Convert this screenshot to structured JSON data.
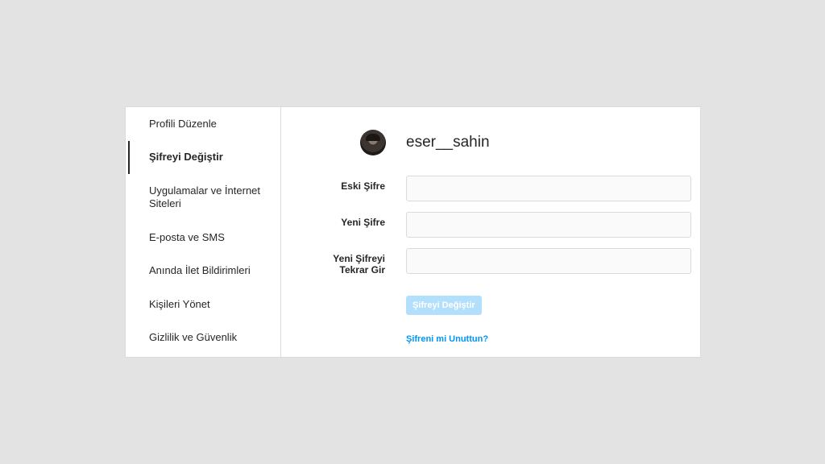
{
  "sidebar": {
    "items": [
      {
        "label": "Profili Düzenle"
      },
      {
        "label": "Şifreyi Değiştir"
      },
      {
        "label": "Uygulamalar ve İnternet Siteleri"
      },
      {
        "label": "E-posta ve SMS"
      },
      {
        "label": "Anında İlet Bildirimleri"
      },
      {
        "label": "Kişileri Yönet"
      },
      {
        "label": "Gizlilik ve Güvenlik"
      }
    ],
    "active_index": 1
  },
  "profile": {
    "username": "eser__sahin"
  },
  "form": {
    "old_password": {
      "label": "Eski Şifre",
      "value": "",
      "placeholder": ""
    },
    "new_password": {
      "label": "Yeni Şifre",
      "value": "",
      "placeholder": ""
    },
    "confirm_password": {
      "label_line1": "Yeni Şifreyi",
      "label_line2": "Tekrar Gir",
      "value": "",
      "placeholder": ""
    },
    "submit_label": "Şifreyi Değiştir",
    "forgot_label": "Şifreni mi Unuttun?"
  },
  "colors": {
    "accent": "#0095f6",
    "button_disabled": "#b2dffc",
    "background": "#e3e3e3",
    "border": "#dbdbdb"
  }
}
